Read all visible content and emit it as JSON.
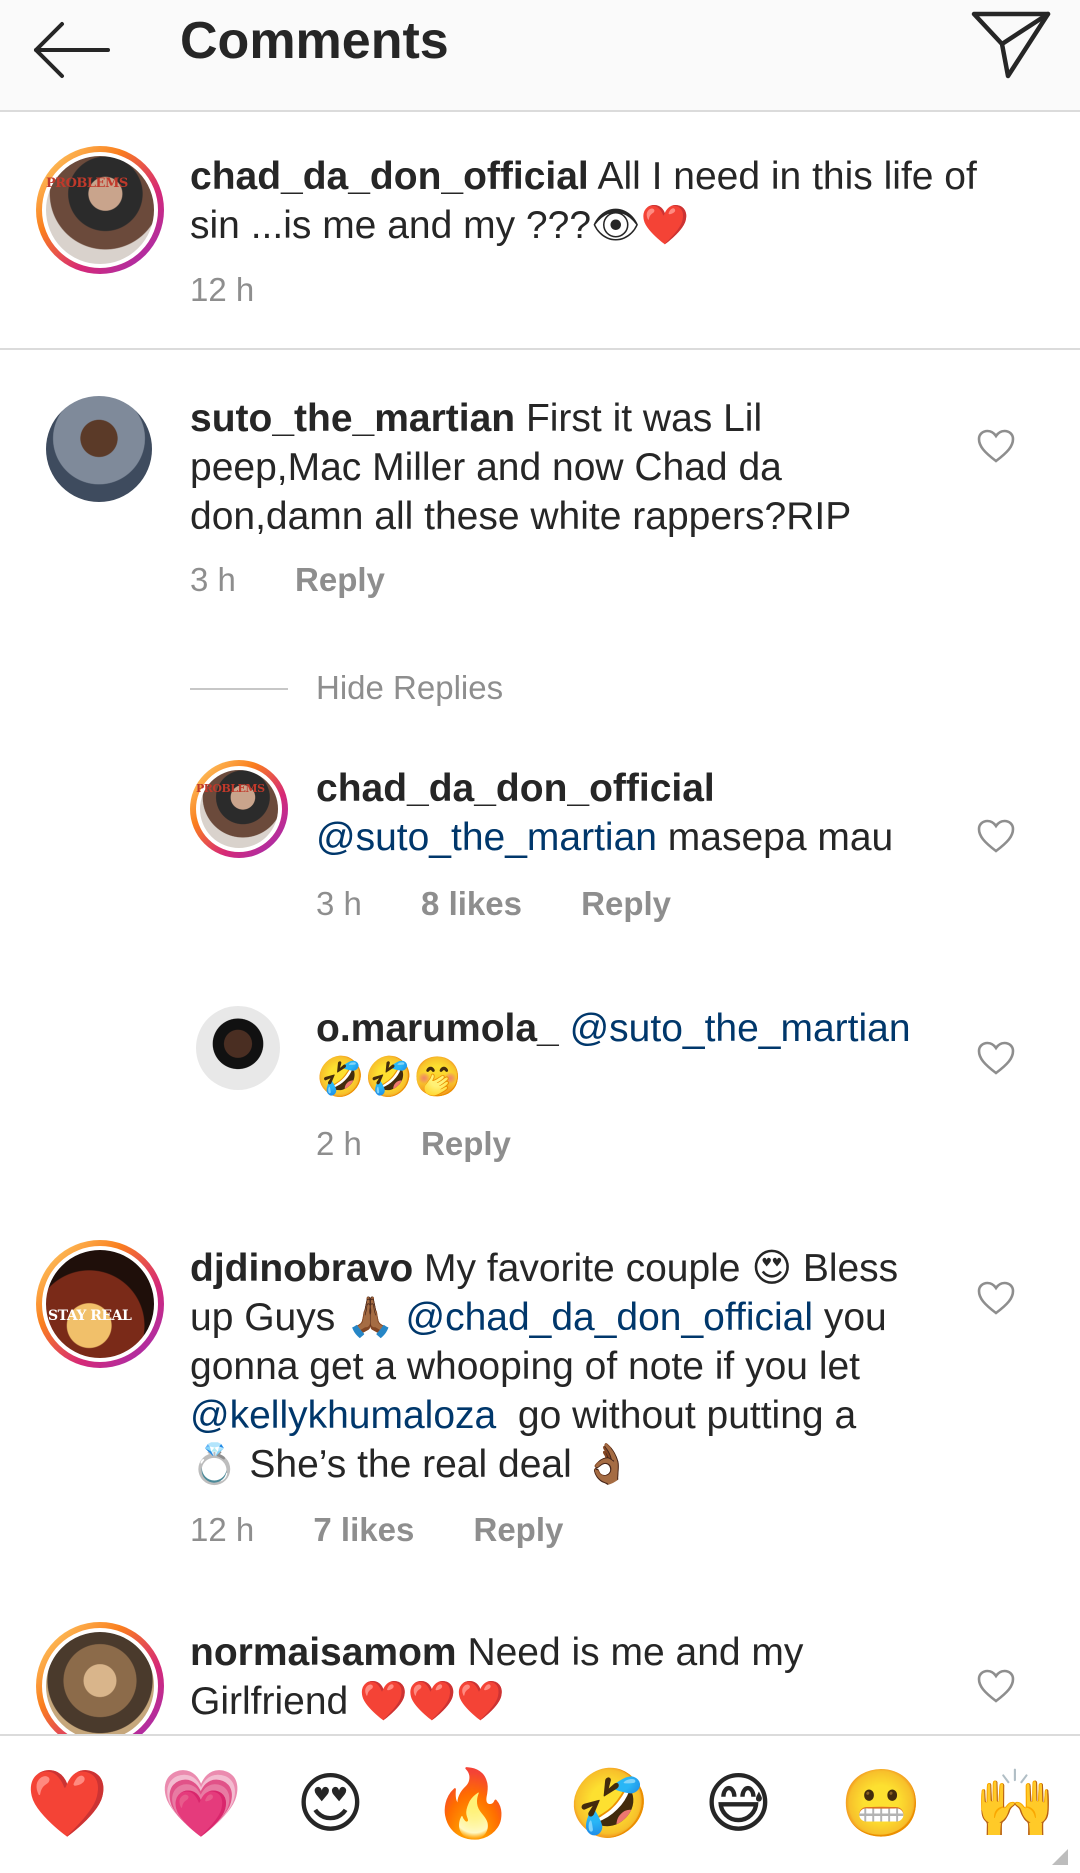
{
  "header": {
    "title": "Comments"
  },
  "caption": {
    "username": "chad_da_don_official",
    "text": "All I need in this life of sin ...is me and my ???👁❤️",
    "time": "12 h",
    "avatar_text": "PROBLEMS"
  },
  "comments": [
    {
      "username": "suto_the_martian",
      "text_line1": "First it was Lil",
      "text_line2": "peep,Mac Miller and now Chad da",
      "text_line3": "don,damn all these white rappers?RIP",
      "time": "3 h",
      "reply_label": "Reply"
    },
    {
      "username": "djdinobravo",
      "text_line1": "My favorite couple 😍 Bless",
      "text_line2_a": "up Guys 🙏🏾",
      "mention1": "@chad_da_don_official",
      "text_line2_b": " you",
      "text_line3": "gonna get a whooping of note if you let",
      "mention2": "@kellykhumaloza",
      "text_line4_b": "  go without putting a",
      "text_line5": "💍 She’s the real deal 👌🏾",
      "time": "12 h",
      "likes": "7 likes",
      "reply_label": "Reply",
      "avatar_text": "STAY REAL"
    },
    {
      "username": "normaisamom",
      "text_line1": "Need is me and my",
      "text_line2": "Girlfriend ❤️❤️❤️"
    }
  ],
  "hide_replies": "Hide Replies",
  "replies": [
    {
      "username": "chad_da_don_official",
      "mention": "@suto_the_martian",
      "text": " masepa mau",
      "time": "3 h",
      "likes": "8 likes",
      "reply_label": "Reply",
      "avatar_text": "PROBLEMS"
    },
    {
      "username": "o.marumola_",
      "mention": "@suto_the_martian",
      "text_line2": "🤣🤣🤭",
      "time": "2 h",
      "reply_label": "Reply"
    }
  ],
  "emoji_bar": [
    "❤️",
    "💗",
    "😍",
    "🔥",
    "🤣",
    "😅",
    "😬",
    "🙌"
  ]
}
